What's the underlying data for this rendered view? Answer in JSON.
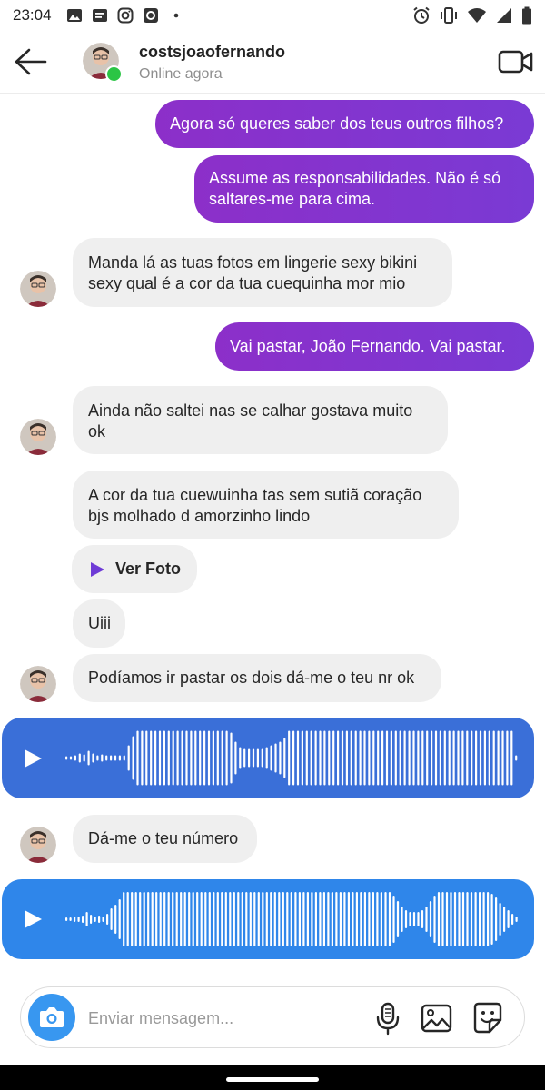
{
  "status_bar": {
    "time": "23:04"
  },
  "header": {
    "username": "costsjoaofernando",
    "status": "Online agora"
  },
  "messages": {
    "m1": "Agora só queres saber dos teus outros filhos?",
    "m2_l1": "Assume as responsabilidades. Não é só",
    "m2_l2": "saltares-me para cima.",
    "m3_l1": "Manda lá as tuas fotos em lingerie sexy bikini",
    "m3_l2": "sexy qual é a cor da tua cuequinha mor mio",
    "m4": "Vai pastar, João Fernando. Vai pastar.",
    "m5_l1": "Ainda não saltei nas se calhar gostava muito",
    "m5_l2": "ok",
    "m6_l1": "A cor da tua cuewuinha tas sem sutiã coração",
    "m6_l2": "bjs molhado d amorzinho lindo",
    "m7_photo": "Ver Foto",
    "m8": "Uiii",
    "m9": "Podíamos ir pastar os dois dá-me o teu nr ok",
    "m11": "Dá-me o teu número"
  },
  "composer": {
    "placeholder": "Enviar mensagem..."
  },
  "icons": {
    "back": "arrow-left-icon",
    "video": "video-camera-icon",
    "camera": "camera-icon",
    "mic": "microphone-icon",
    "gallery": "image-icon",
    "sticker": "sticker-icon",
    "play": "play-icon"
  },
  "colors": {
    "outgoing_bubble": "#8436cf",
    "incoming_bubble": "#efefef",
    "voice_1": "#3a6fd8",
    "voice_2": "#2f86ea",
    "online": "#2bc545",
    "camera_button": "#3897f0"
  }
}
